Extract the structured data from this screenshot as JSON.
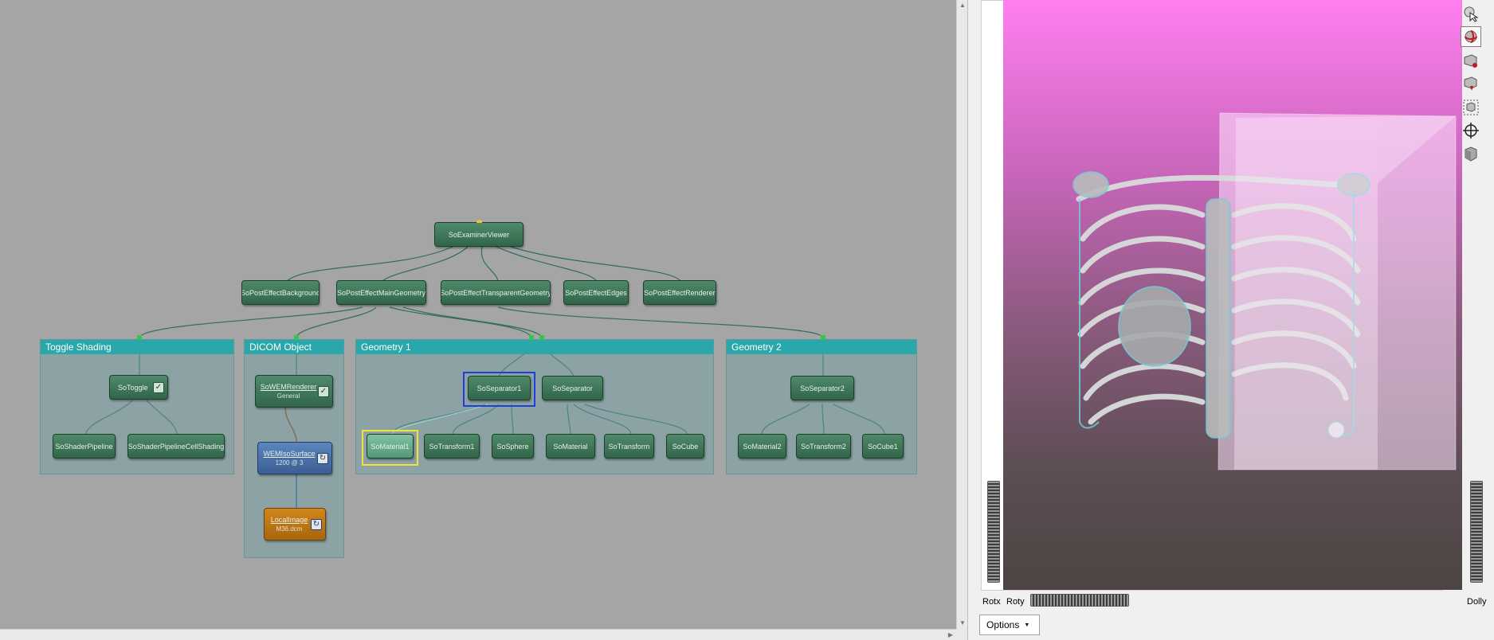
{
  "network": {
    "modules": {
      "examiner_viewer": "SoExaminerViewer",
      "post_effect_background": "SoPostEffectBackground",
      "post_effect_main_geometry": "SoPostEffectMainGeometry",
      "post_effect_transparent_geometry": "SoPostEffectTransparentGeometry",
      "post_effect_edges": "SoPostEffectEdges",
      "post_effect_renderer": "SoPostEffectRenderer",
      "toggle": "SoToggle",
      "shader_pipeline": "SoShaderPipeline",
      "shader_pipeline_cell_shading": "SoShaderPipelineCellShading",
      "wem_renderer": "SoWEMRenderer",
      "wem_renderer_sub": "General",
      "wem_iso_surface": "WEMIsoSurface",
      "wem_iso_surface_sub": "1200 @ 3",
      "local_image": "LocalImage",
      "local_image_sub": "M36.dcm",
      "separator1": "SoSeparator1",
      "separator": "SoSeparator",
      "material1": "SoMaterial1",
      "transform1": "SoTransform1",
      "sphere": "SoSphere",
      "material": "SoMaterial",
      "transform": "SoTransform",
      "cube": "SoCube",
      "separator2": "SoSeparator2",
      "material2": "SoMaterial2",
      "transform2": "SoTransform2",
      "cube1": "SoCube1"
    },
    "groups": {
      "toggle_shading": "Toggle Shading",
      "dicom_object": "DICOM Object",
      "geometry1": "Geometry 1",
      "geometry2": "Geometry 2"
    },
    "colors": {
      "canvas": "#a5a5a5",
      "group_header": "#2aa7aa",
      "module_green": "#3f7659",
      "module_blue": "#4a72a8",
      "module_orange": "#bd7514",
      "wire": "#2f6d64",
      "selection_blue": "#1f3fd9",
      "selection_yellow": "#f2e23a"
    }
  },
  "viewer": {
    "labels": {
      "rotx": "Rotx",
      "roty": "Roty",
      "dolly": "Dolly"
    },
    "options_button": "Options",
    "toolbar_icons": [
      "pointer-icon",
      "examine-rotate-icon",
      "seek-icon",
      "view-home-icon",
      "set-home-icon",
      "view-all-icon",
      "perspective-cube-icon"
    ],
    "background_gradient": [
      "#ff7ff0",
      "#c765b9",
      "#8b5a7e",
      "#5f4e56",
      "#4b4542"
    ]
  }
}
